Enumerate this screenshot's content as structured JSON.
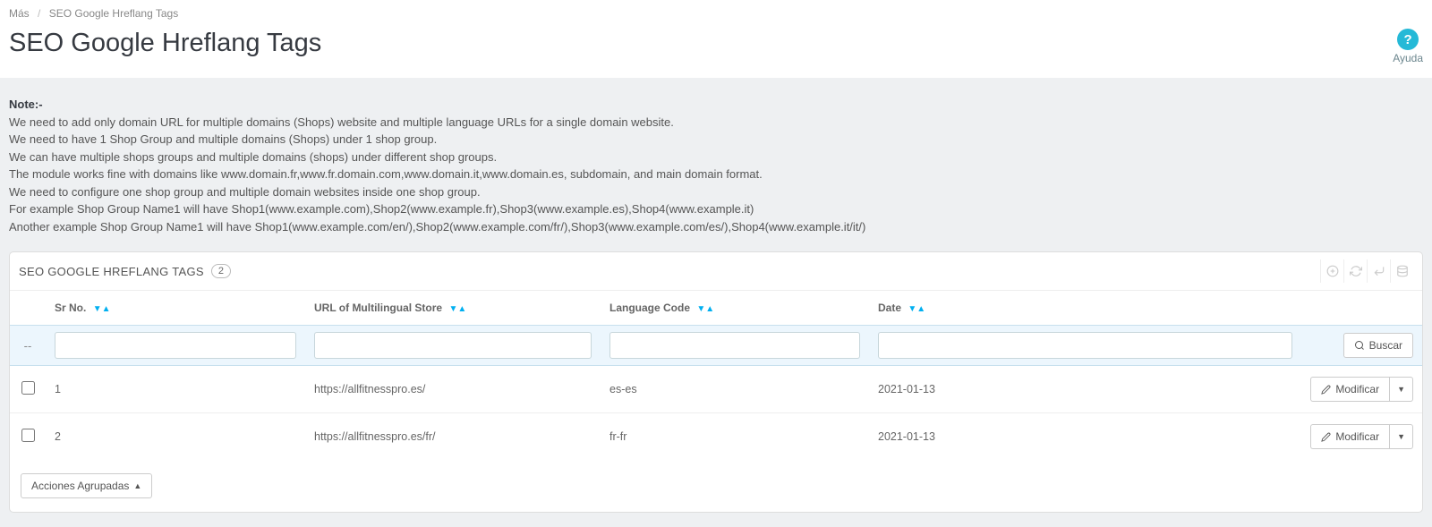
{
  "breadcrumb": {
    "parent": "Más",
    "current": "SEO Google Hreflang Tags"
  },
  "page_title": "SEO Google Hreflang Tags",
  "help": {
    "label": "Ayuda"
  },
  "note": {
    "title": "Note:-",
    "lines": [
      "We need to add only domain URL for multiple domains (Shops) website and multiple language URLs for a single domain website.",
      "We need to have 1 Shop Group and multiple domains (Shops) under 1 shop group.",
      "We can have multiple shops groups and multiple domains (shops) under different shop groups.",
      "The module works fine with domains like www.domain.fr,www.fr.domain.com,www.domain.it,www.domain.es, subdomain, and main domain format.",
      "We need to configure one shop group and multiple domain websites inside one shop group.",
      "For example Shop Group Name1 will have Shop1(www.example.com),Shop2(www.example.fr),Shop3(www.example.es),Shop4(www.example.it)",
      "Another example Shop Group Name1 will have Shop1(www.example.com/en/),Shop2(www.example.com/fr/),Shop3(www.example.com/es/),Shop4(www.example.it/it/)"
    ]
  },
  "panel": {
    "title": "SEO GOOGLE HREFLANG TAGS",
    "count": "2"
  },
  "columns": {
    "sr": "Sr No.",
    "url": "URL of Multilingual Store",
    "lang": "Language Code",
    "date": "Date"
  },
  "search_button": "Buscar",
  "modify_button": "Modificar",
  "bulk_actions_button": "Acciones Agrupadas",
  "rows": [
    {
      "sr": "1",
      "url": "https://allfitnesspro.es/",
      "lang": "es-es",
      "date": "2021-01-13"
    },
    {
      "sr": "2",
      "url": "https://allfitnesspro.es/fr/",
      "lang": "fr-fr",
      "date": "2021-01-13"
    }
  ]
}
